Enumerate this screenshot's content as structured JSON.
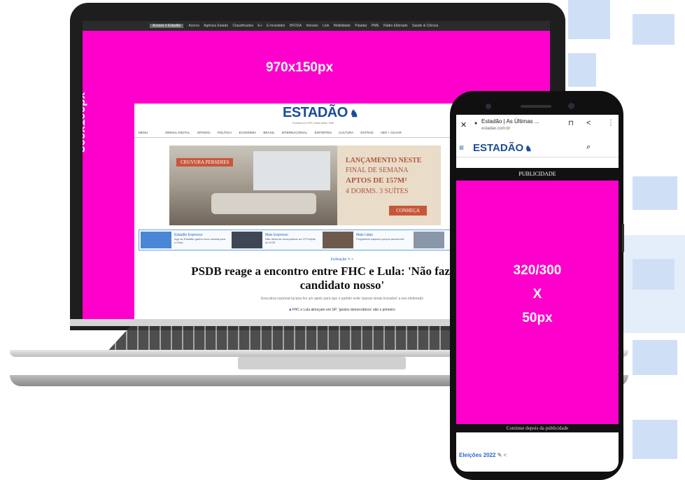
{
  "colors": {
    "ad_magenta": "#ff00cc",
    "brand_blue": "#1a4c9c",
    "decor_blue": "#cfe0f6"
  },
  "laptop": {
    "top_nav": {
      "highlight": "Acesse o Estadão",
      "items": [
        "Acervo",
        "Agência Estado",
        "Classificados",
        "E+",
        "E-Investidor",
        "BFOSA",
        "Imóveis",
        "Link",
        "Mobilidade",
        "Paladar",
        "PME",
        "Rádio Eldorado",
        "Saúde & Ciência"
      ]
    },
    "banner_label": "970x150px",
    "side_label": "300x100px",
    "site": {
      "logo": "ESTADÃO",
      "logo_tagline": "Fundado em 1875, online desde 1995",
      "nav": [
        "MENU",
        "JORNAL DIGITAL",
        "OPINIÃO",
        "POLÍTICA",
        "ECONOMIA",
        "BRASIL",
        "INTERNACIONAL",
        "ESPORTES",
        "CULTURA",
        "ESTRAD",
        "VER + OLHAR"
      ],
      "ad": {
        "tag": "CRUVURA PERSERES",
        "line1": "LANÇAMENTO NESTE",
        "line2": "FINAL DE SEMANA",
        "line3": "APTOS DE 157M²",
        "line4": "4 DORMS. 3 SUÍTES",
        "button": "CONHEÇA"
      },
      "cards": [
        {
          "title": "Estadão Expresso",
          "text": "App do Estadão ganha nova rodada para e-Pass"
        },
        {
          "title": "Mais Expresso",
          "text": "Não deixa de acompanhar as 12ª edição do HOD"
        },
        {
          "title": "Mais Lidas",
          "text": "Programas capazes preços acessíveis"
        }
      ],
      "kicker": "Inclinação",
      "headline_line1": "PSDB reage a encontro entre FHC e Lula: 'Não faz bem a p",
      "headline_line2": "candidato nosso'",
      "subhead": "Executiva nacional tucana fez um apelo para que o partido evite 'passar sinais trocados' a seu eleitorado",
      "bullet": "FHC e Lula almoçam em SP; 'gestos democráticos' são o primeiro"
    }
  },
  "phone": {
    "tab_title": "Estadão | As Últimas ...",
    "url": "estadao.com.br",
    "logo": "ESTADÃO",
    "publicidade": "PUBLICIDADE",
    "ad_label_line1": "320/300",
    "ad_label_line2": "X",
    "ad_label_line3": "50px",
    "continue_text": "Continue depois da publicidade",
    "section_link": "Eleições 2022"
  }
}
